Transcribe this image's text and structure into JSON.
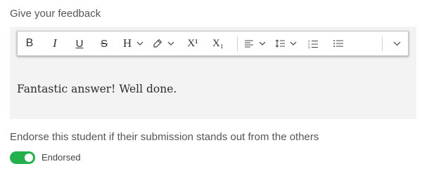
{
  "feedback": {
    "label": "Give your feedback",
    "content": "Fantastic answer! Well done."
  },
  "toolbar": {
    "bold": "B",
    "italic": "I",
    "underline": "U",
    "strike": "S",
    "heading": "H",
    "superscript": "X¹",
    "subscript": "X₁"
  },
  "endorse": {
    "prompt": "Endorse this student if their submission stands out from the others",
    "toggle_label": "Endorsed",
    "toggle_on": true,
    "toggle_color": "#22b14c"
  }
}
